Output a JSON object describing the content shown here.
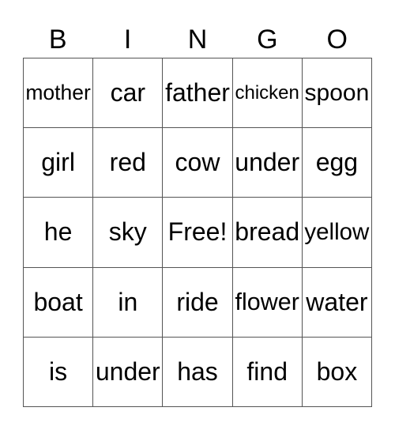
{
  "header": [
    "B",
    "I",
    "N",
    "G",
    "O"
  ],
  "cells": [
    [
      "mother",
      "car",
      "father",
      "chicken",
      "spoon"
    ],
    [
      "girl",
      "red",
      "cow",
      "under",
      "egg"
    ],
    [
      "he",
      "sky",
      "Free!",
      "bread",
      "yellow"
    ],
    [
      "boat",
      "in",
      "ride",
      "flower",
      "water"
    ],
    [
      "is",
      "under",
      "has",
      "find",
      "box"
    ]
  ]
}
